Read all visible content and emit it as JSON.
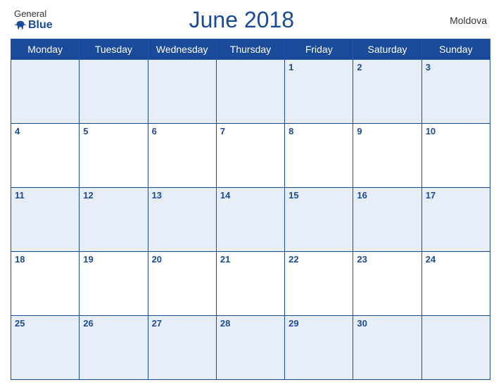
{
  "header": {
    "logo_general": "General",
    "logo_blue": "Blue",
    "title": "June 2018",
    "country": "Moldova"
  },
  "weekdays": [
    "Monday",
    "Tuesday",
    "Wednesday",
    "Thursday",
    "Friday",
    "Saturday",
    "Sunday"
  ],
  "weeks": [
    [
      null,
      null,
      null,
      null,
      1,
      2,
      3
    ],
    [
      4,
      5,
      6,
      7,
      8,
      9,
      10
    ],
    [
      11,
      12,
      13,
      14,
      15,
      16,
      17
    ],
    [
      18,
      19,
      20,
      21,
      22,
      23,
      24
    ],
    [
      25,
      26,
      27,
      28,
      29,
      30,
      null
    ]
  ]
}
